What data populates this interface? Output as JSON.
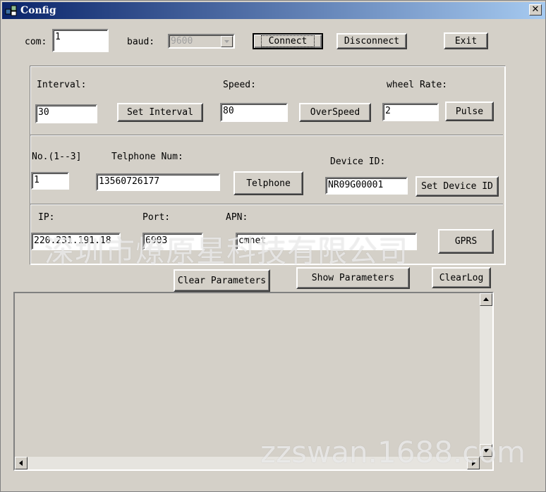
{
  "window": {
    "title": "Config",
    "close_glyph": "✕"
  },
  "connection": {
    "com_label": "com:",
    "com_value": "1",
    "baud_label": "baud:",
    "baud_value": "9600",
    "connect_label": "Connect",
    "disconnect_label": "Disconnect",
    "exit_label": "Exit"
  },
  "settings": {
    "interval_label": "Interval:",
    "interval_value": "30",
    "set_interval_label": "Set Interval",
    "speed_label": "Speed:",
    "speed_value": "80",
    "overspeed_label": "OverSpeed",
    "wheel_rate_label": "wheel Rate:",
    "wheel_rate_value": "2",
    "pulse_label": "Pulse"
  },
  "telephone": {
    "no_label": "No.(1--3]",
    "no_value": "1",
    "telphone_num_label": "Telphone Num:",
    "telphone_num_value": "13560726177",
    "telphone_button": "Telphone",
    "device_id_label": "Device ID:",
    "device_id_value": "NR09G00001",
    "set_device_id_label": "Set Device ID"
  },
  "gprs": {
    "ip_label": "IP:",
    "ip_value": "220.231.191.18",
    "port_label": "Port:",
    "port_value": "6903",
    "apn_label": "APN:",
    "apn_value": "cmnet",
    "gprs_button": "GPRS"
  },
  "actions": {
    "clear_parameters": "Clear Parameters",
    "show_parameters": "Show Parameters",
    "clear_log": "ClearLog"
  },
  "watermarks": {
    "company": "深圳市燎原星科技有限公司",
    "site": "zzswan.1688.com"
  }
}
